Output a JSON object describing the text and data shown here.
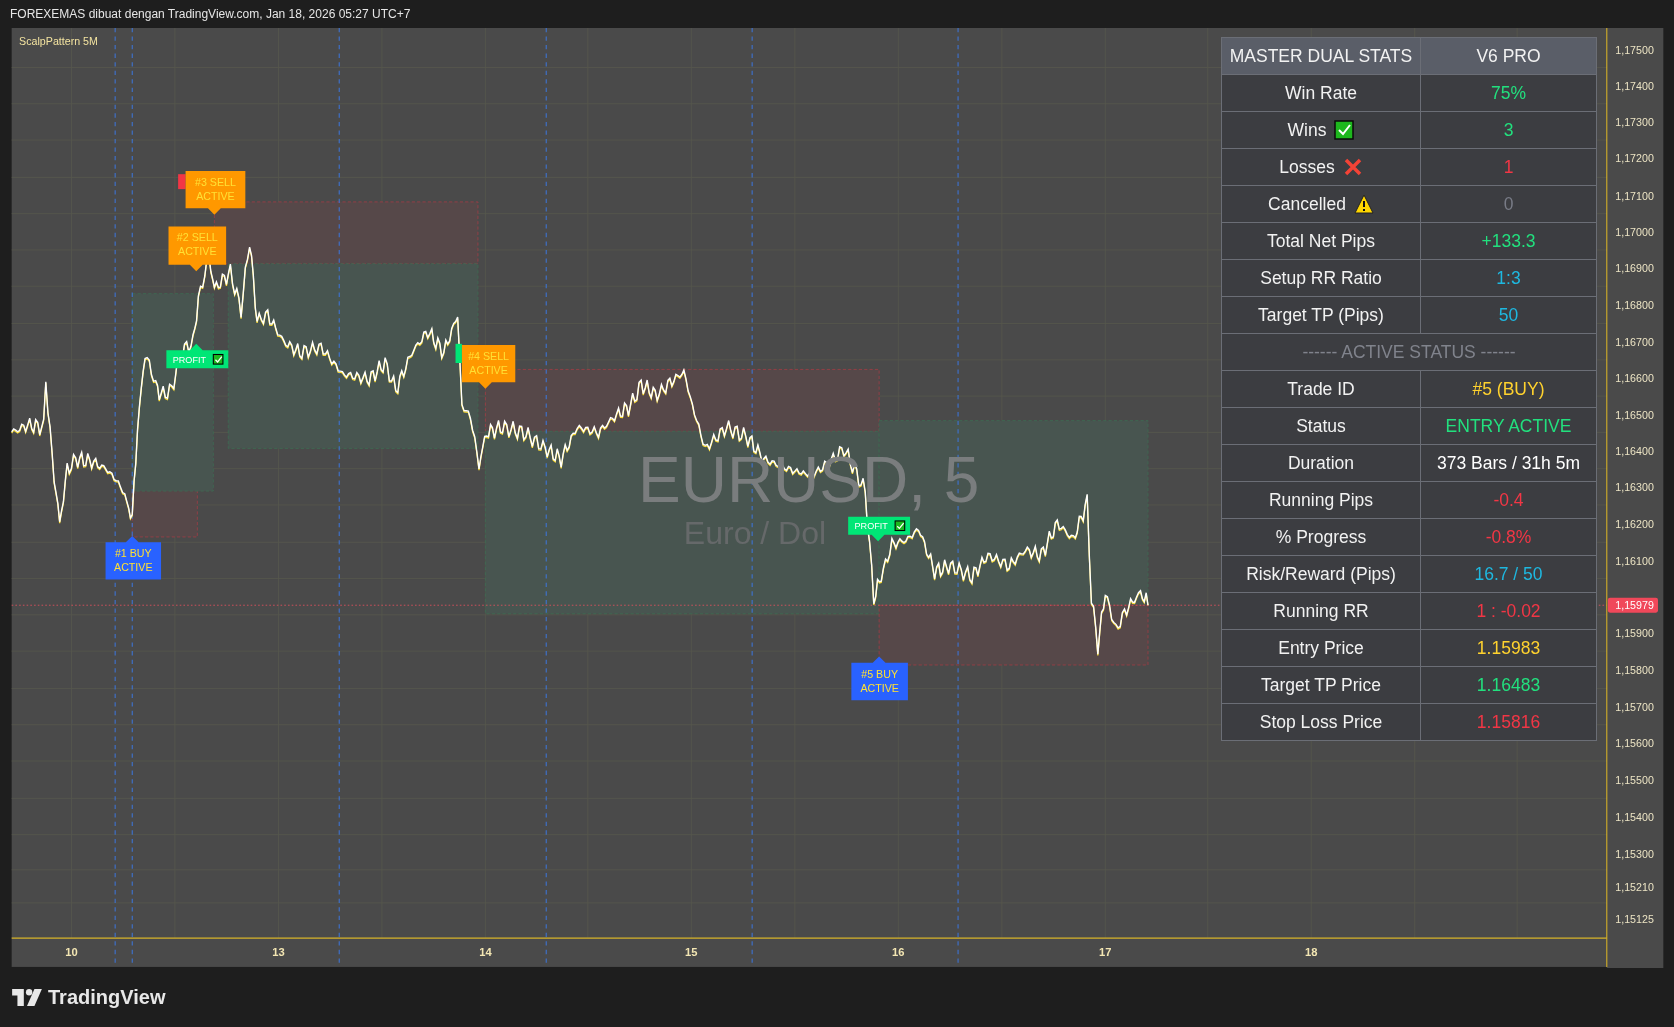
{
  "caption": "FOREXEMAS dibuat dengan TradingView.com, Jan 18, 2026 05:27 UTC+7",
  "chart": {
    "indicator": "ScalpPattern 5M",
    "symbol_watermark": "EURUSD, 5",
    "description_watermark": "Euro / Dol",
    "signals": [
      {
        "kind": "buy",
        "lines": [
          "#1 BUY",
          "ACTIVE"
        ]
      },
      {
        "kind": "sell",
        "lines": [
          "#3 SELL",
          "ACTIVE"
        ]
      },
      {
        "kind": "sell",
        "lines": [
          "#2 SELL",
          "ACTIVE"
        ]
      },
      {
        "kind": "profit",
        "lines": [
          "PROFIT"
        ]
      },
      {
        "kind": "sell",
        "lines": [
          "#4 SELL",
          "ACTIVE"
        ]
      },
      {
        "kind": "profit",
        "lines": [
          "PROFIT"
        ]
      },
      {
        "kind": "buy",
        "lines": [
          "#5 BUY",
          "ACTIVE"
        ]
      }
    ],
    "price_axis": [
      "1,17500",
      "1,17400",
      "1,17300",
      "1,17200",
      "1,17100",
      "1,17000",
      "1,16900",
      "1,16800",
      "1,16700",
      "1,16600",
      "1,16500",
      "1,16400",
      "1,16300",
      "1,16200",
      "1,16100",
      "1,15900",
      "1,15800",
      "1,15700",
      "1,15600",
      "1,15500",
      "1,15400",
      "1,15300",
      "1,15210",
      "1,15125"
    ],
    "current_price": "1,15979",
    "time_axis": [
      "10",
      "13",
      "14",
      "15",
      "16",
      "17",
      "18"
    ]
  },
  "stats": {
    "header": [
      "MASTER DUAL STATS",
      "V6 PRO"
    ],
    "rows": [
      {
        "kind": "stat",
        "label": "Win Rate",
        "value": "75%",
        "color": "#22e07e"
      },
      {
        "kind": "win",
        "label": "Wins",
        "value": "3",
        "color": "#22e07e"
      },
      {
        "kind": "loss",
        "label": "Losses",
        "value": "1",
        "color": "#f23645"
      },
      {
        "kind": "cancel",
        "label": "Cancelled",
        "value": "0",
        "color": "#787b86"
      },
      {
        "kind": "stat",
        "label": "Total Net Pips",
        "value": "+133.3",
        "color": "#22e07e"
      },
      {
        "kind": "stat",
        "label": "Setup RR Ratio",
        "value": "1:3",
        "color": "#1eb8e0"
      },
      {
        "kind": "stat",
        "label": "Target TP (Pips)",
        "value": "50",
        "color": "#1eb8e0"
      },
      {
        "kind": "section",
        "label": "------ ACTIVE STATUS ------"
      },
      {
        "kind": "stat",
        "label": "Trade ID",
        "value": "#5 (BUY)",
        "color": "#ffd22e"
      },
      {
        "kind": "stat",
        "label": "Status",
        "value": "ENTRY ACTIVE",
        "color": "#22e07e"
      },
      {
        "kind": "stat",
        "label": "Duration",
        "value": "373 Bars / 31h 5m",
        "color": "#ffffff"
      },
      {
        "kind": "stat",
        "label": "Running Pips",
        "value": "-0.4",
        "color": "#f23645"
      },
      {
        "kind": "stat",
        "label": "% Progress",
        "value": "-0.8%",
        "color": "#f23645"
      },
      {
        "kind": "stat",
        "label": "Risk/Reward (Pips)",
        "value": "16.7 / 50",
        "color": "#1eb8e0"
      },
      {
        "kind": "stat",
        "label": "Running RR",
        "value": "1 : -0.02",
        "color": "#f23645"
      },
      {
        "kind": "stat",
        "label": "Entry Price",
        "value": "1.15983",
        "color": "#ffd22e"
      },
      {
        "kind": "stat",
        "label": "Target TP Price",
        "value": "1.16483",
        "color": "#22e07e"
      },
      {
        "kind": "stat",
        "label": "Stop Loss Price",
        "value": "1.15816",
        "color": "#f23645"
      }
    ]
  },
  "footer": {
    "brand": "TradingView"
  }
}
